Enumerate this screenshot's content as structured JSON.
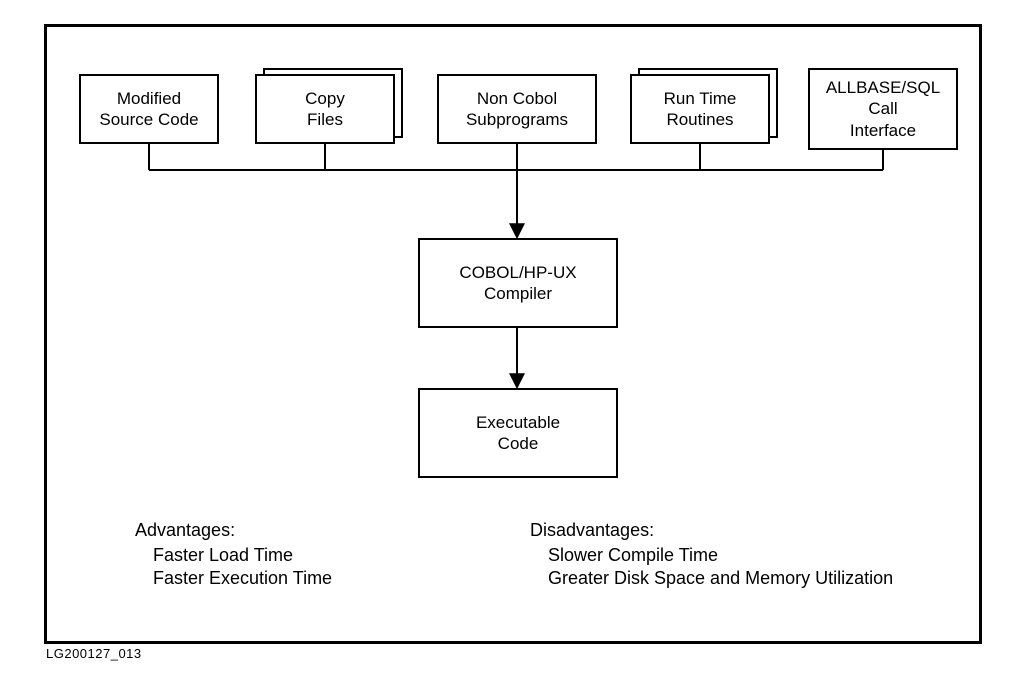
{
  "figure_id": "LG200127_013",
  "boxes": {
    "modified_source": [
      "Modified",
      "Source Code"
    ],
    "copy_files": [
      "Copy",
      "Files"
    ],
    "non_cobol": [
      "Non Cobol",
      "Subprograms"
    ],
    "runtime": [
      "Run Time",
      "Routines"
    ],
    "allbase": [
      "ALLBASE/SQL",
      "Call",
      "Interface"
    ],
    "compiler": [
      "COBOL/HP-UX",
      "Compiler"
    ],
    "executable": [
      "Executable",
      "Code"
    ]
  },
  "advantages": {
    "title": "Advantages:",
    "items": [
      "Faster Load Time",
      "Faster Execution Time"
    ]
  },
  "disadvantages": {
    "title": "Disadvantages:",
    "items": [
      "Slower Compile Time",
      "Greater Disk Space and Memory Utilization"
    ]
  }
}
